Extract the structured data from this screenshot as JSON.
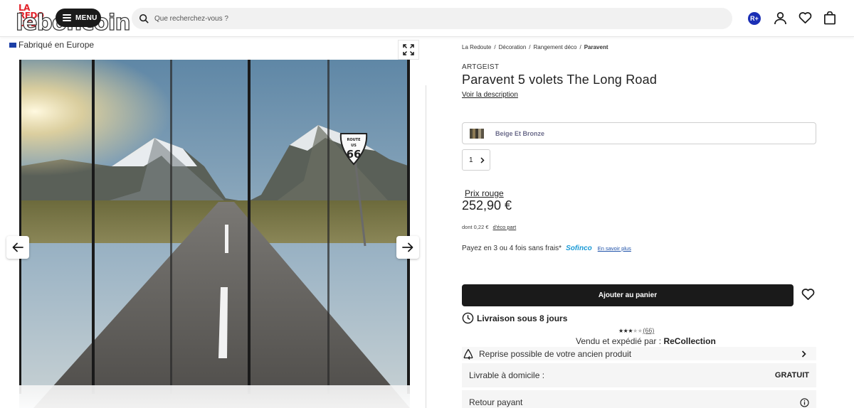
{
  "header": {
    "logo_top": "LA REDOUTE",
    "logo_main": "leboncoin",
    "menu_label": "MENU",
    "search_placeholder": "Que recherchez-vous ?",
    "loyalty_badge": "R+",
    "icons": [
      "search-icon",
      "account-icon",
      "heart-icon",
      "bag-icon"
    ]
  },
  "gallery": {
    "origin_label": "Fabriqué en Europe",
    "image_content": "folding screen with mountain road and Route US 66 sign",
    "sign_top": "ROUTE",
    "sign_us": "US",
    "sign_num": "66"
  },
  "breadcrumb": [
    "La Redoute",
    "Décoration",
    "Rangement déco",
    "Paravent"
  ],
  "product": {
    "brand": "ARTGEIST",
    "title": "Paravent 5 volets The Long Road",
    "description_link": "Voir la description",
    "variant_label": "Beige Et Bronze",
    "quantity": "1",
    "price_label": "Prix rouge",
    "price": "252,90 €",
    "eco_text": "dont 0,22 €",
    "eco_link": "d'éco part",
    "payment_text": "Payez en 3 ou 4 fois sans frais*",
    "payment_brand": "Sofinco",
    "payment_more": "En savoir plus",
    "add_to_cart": "Ajouter au panier",
    "delivery": "Livraison sous 8 jours",
    "rating_stars": 3,
    "rating_count": "(66)",
    "seller_prefix": "Vendu et expédié par : ",
    "seller_name": "ReCollection",
    "take_back": "Reprise possible de votre ancien produit",
    "home_delivery_label": "Livrable à domicile :",
    "home_delivery_value": "GRATUIT",
    "returns_label": "Retour payant"
  },
  "colors": {
    "accent_dark": "#1a1a1a",
    "loyalty_blue": "#1b2fb5",
    "sofinco_blue": "#1b9ad6",
    "logo_red": "#e3232b"
  }
}
